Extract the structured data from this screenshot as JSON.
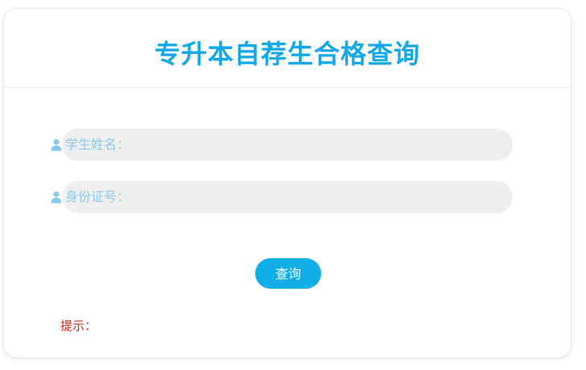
{
  "header": {
    "title": "专升本自荐生合格查询"
  },
  "form": {
    "name_label": "学生姓名：",
    "id_label": "身份证号：",
    "name_value": "",
    "id_value": "",
    "user_icon": "user-icon"
  },
  "actions": {
    "submit_label": "查询"
  },
  "notice": {
    "label": "提示："
  },
  "colors": {
    "title": "#12a8e9",
    "button": "#12aeea",
    "label": "#88c9ef",
    "field_bg": "#efefef",
    "notice": "#e0201e"
  }
}
